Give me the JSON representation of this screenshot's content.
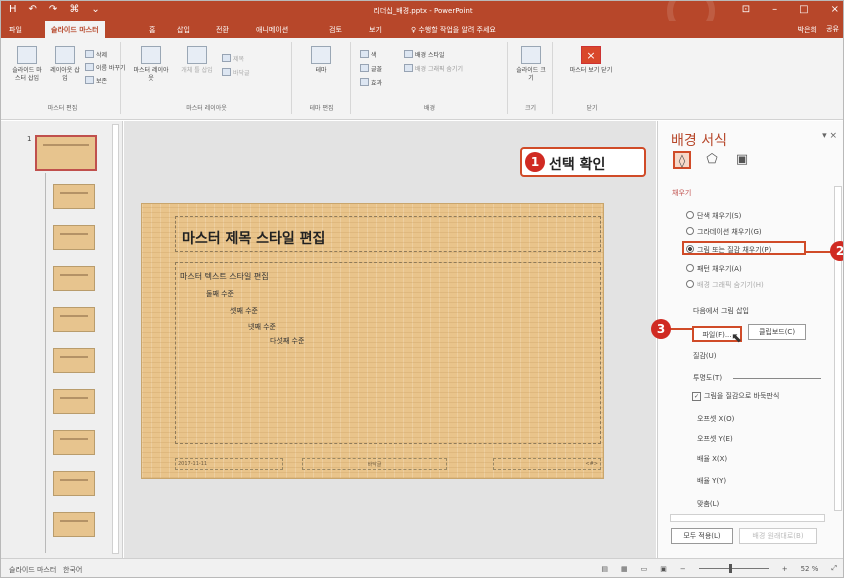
{
  "app": {
    "title": "리더십_배경.pptx - PowerPoint",
    "quick_access": [
      "H",
      "↶",
      "↷",
      "⌘",
      "⌄"
    ],
    "window_controls": [
      "⊡",
      "–",
      "□",
      "×"
    ]
  },
  "tabs": {
    "items": [
      "파일",
      "슬라이드 마스터",
      "홈",
      "삽입",
      "전환",
      "애니메이션",
      "검토",
      "보기",
      "♀ 수행할 작업을 알려 주세요"
    ],
    "user": "박은희",
    "share": "공유"
  },
  "ribbon": {
    "groups": [
      {
        "label": "마스터 편집",
        "buttons": [
          "슬라이드 마 스터 삽입",
          "레이아웃 삽입",
          "삭제",
          "이름 바꾸기",
          "보존"
        ]
      },
      {
        "label": "마스터 레이아웃",
        "buttons": [
          "마스터 레이아웃",
          "개체 틀 삽입",
          "제목",
          "바닥글"
        ]
      },
      {
        "label": "테마 편집",
        "buttons": [
          "테마"
        ]
      },
      {
        "label": "배경",
        "buttons": [
          "색",
          "글꼴",
          "효과",
          "배경 스타일",
          "배경 그래픽 숨기기"
        ]
      },
      {
        "label": "크기",
        "buttons": [
          "슬라이드 크기"
        ]
      },
      {
        "label": "닫기",
        "buttons": [
          "마스터 보기 닫기"
        ]
      }
    ]
  },
  "thumbnails": {
    "master_number": "1",
    "layouts_count": 11
  },
  "slide": {
    "title": "마스터 제목 스타일 편집",
    "bullets": [
      "마스터 텍스트 스타일 편집",
      "둘째 수준",
      "셋째 수준",
      "넷째 수준",
      "다섯째 수준"
    ],
    "footer": [
      "2017-11-11",
      "바닥글",
      "<#>"
    ]
  },
  "pane": {
    "title": "배경 서식",
    "controls": "▾ ×",
    "icons": [
      "paint-bucket-icon",
      "pentagon-icon",
      "image-icon"
    ],
    "section": "채우기",
    "fill_options": [
      "단색 채우기(S)",
      "그라데이션 채우기(G)",
      "그림 또는 질감 채우기(P)",
      "패턴 채우기(A)",
      "배경 그래픽 숨기기(H)"
    ],
    "insert_label": "다음에서 그림 삽입",
    "file_button": "파일(F)...",
    "clipboard_button": "클립보드(C)",
    "texture_label": "질감(U)",
    "transparency_label": "투명도(T)",
    "tile_checkbox": "그림을 질감으로 바둑판식",
    "fields": [
      "오프셋 X(O)",
      "오프셋 Y(E)",
      "배율 X(X)",
      "배율 Y(Y)",
      "맞춤(L)"
    ],
    "reset_all": "모두 적용(L)",
    "reset_background": "배경 원래대로(B)"
  },
  "callouts": {
    "one": {
      "num": "1",
      "text": "선택 확인"
    },
    "two": {
      "num": "2"
    },
    "three": {
      "num": "3"
    }
  },
  "status": {
    "left": "슬라이드 마스터",
    "language": "한국어",
    "zoom": "52 %"
  }
}
